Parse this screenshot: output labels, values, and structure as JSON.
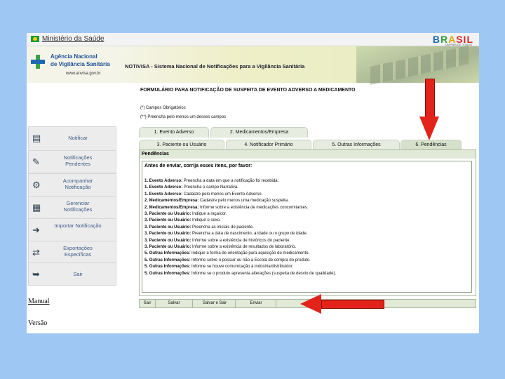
{
  "govbar": {
    "label": "Ministério da Saúde",
    "brasil": [
      "B",
      "R",
      "A",
      "SIL"
    ],
    "brasil_tag": "UM PAÍS DE TODOS"
  },
  "header": {
    "agency_line1": "Agência Nacional",
    "agency_line2": "de Vigilância Sanitária",
    "agency_url": "www.anvisa.gov.br",
    "system_title": "NOTIVISA - Sistema Nacional de Notificações para a Vigilância Sanitária"
  },
  "form": {
    "title": "FORMULÁRIO PARA NOTIFICAÇÃO DE SUSPEITA DE EVENTO ADVERSO A MEDICAMENTO",
    "note1": "(*) Campos Obrigatórios",
    "note2": "(**) Preencha pelo menos um desses campos",
    "tabs": [
      "1. Evento Adverso",
      "2. Medicamentos/Empresa",
      "3. Paciente ou Usuário",
      "4. Notificador Primário",
      "5. Outras Informações",
      "6. Pendências"
    ],
    "panel_title": "Pendências",
    "pending_header": "Antes de enviar, corrija esses itens, por favor:",
    "pending": [
      {
        "section": "1. Evento Adverso:",
        "text": " Preencha a data em que a notificação foi recebida."
      },
      {
        "section": "1. Evento Adverso:",
        "text": " Preencha o campo Narrativa."
      },
      {
        "section": "1. Evento Adverso:",
        "text": " Cadastre pelo menos um Evento Adverso."
      },
      {
        "section": "2. Medicamentos/Empresa:",
        "text": " Cadastre pelo menos uma medicação suspeita."
      },
      {
        "section": "2. Medicamentos/Empresa:",
        "text": " Informe sobre a existência de medicações concomitantes."
      },
      {
        "section": "3. Paciente ou Usuário:",
        "text": " Indique a raça/cor."
      },
      {
        "section": "3. Paciente ou Usuário:",
        "text": " Indique o sexo."
      },
      {
        "section": "3. Paciente ou Usuário:",
        "text": " Preencha as iniciais do paciente."
      },
      {
        "section": "3. Paciente ou Usuário:",
        "text": " Preencha a data de nascimento, a idade ou o grupo de idade."
      },
      {
        "section": "3. Paciente ou Usuário:",
        "text": " Informe sobre a existência de históricos do paciente."
      },
      {
        "section": "3. Paciente ou Usuário:",
        "text": " Informe sobre a existência de resultados de laboratório."
      },
      {
        "section": "5. Outras Informações:",
        "text": " Indique a forma de orientação para aquisição do medicamento."
      },
      {
        "section": "5. Outras Informações:",
        "text": " Informe sobre o possuir ou não a Escola de compra do produto."
      },
      {
        "section": "5. Outras Informações:",
        "text": " Informe se houve comunicação à indústria/distribuidor."
      },
      {
        "section": "5. Outras Informações:",
        "text": " Informe se o produto apresenta alterações (suspeita de desvio de qualidade)."
      }
    ],
    "buttons": {
      "sair": "Sair",
      "salvar": "Salvar",
      "salvar_sair": "Salvar e Sair",
      "enviar": "Enviar"
    }
  },
  "sidebar": {
    "items": [
      {
        "label": "Notificar",
        "icon": "document-icon"
      },
      {
        "label": "Notificações Pendentes",
        "icon": "pending-icon"
      },
      {
        "label": "Acompanhar Notificação",
        "icon": "track-icon"
      },
      {
        "label": "Gerenciar Notificações",
        "icon": "manage-icon"
      },
      {
        "label": "Importar Notificação",
        "icon": "import-icon"
      },
      {
        "label": "Exportações Específicas",
        "icon": "export-icon"
      },
      {
        "label": "Sair",
        "icon": "exit-icon"
      }
    ]
  },
  "links": {
    "manual": "Manual",
    "versao": "Versão"
  },
  "colors": {
    "background": "#9ec7f4",
    "arrow": "#e2231a",
    "panel": "#e1e9d8"
  }
}
